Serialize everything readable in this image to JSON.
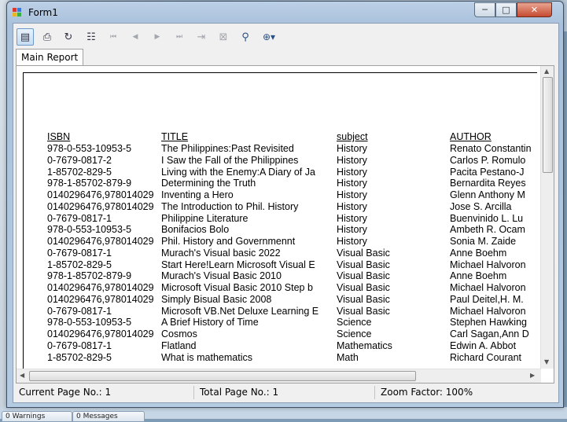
{
  "window": {
    "title": "Form1",
    "controls": {
      "minimize": "─",
      "maximize": "□",
      "close": "✕"
    }
  },
  "toolbar": {
    "buttons": [
      {
        "name": "export-report-icon",
        "glyph": "▤"
      },
      {
        "name": "print-icon",
        "glyph": "⎙"
      },
      {
        "name": "refresh-icon",
        "glyph": "↻"
      },
      {
        "name": "toggle-group-tree-icon",
        "glyph": "☷"
      },
      {
        "name": "first-page-icon",
        "glyph": "⏮"
      },
      {
        "name": "previous-page-icon",
        "glyph": "◀"
      },
      {
        "name": "next-page-icon",
        "glyph": "▶"
      },
      {
        "name": "last-page-icon",
        "glyph": "⏭"
      },
      {
        "name": "go-to-page-icon",
        "glyph": "⇥"
      },
      {
        "name": "close-current-view-icon",
        "glyph": "⊠"
      },
      {
        "name": "find-binoculars-icon",
        "glyph": "⚲"
      },
      {
        "name": "zoom-icon",
        "glyph": "⊕▾"
      }
    ]
  },
  "tab": {
    "label": "Main Report"
  },
  "report": {
    "headers": {
      "isbn": "ISBN",
      "title": "TITLE",
      "subject": "subject",
      "author": "AUTHOR"
    },
    "rows": [
      {
        "isbn": "978-0-553-10953-5",
        "title": "The Philippines:Past Revisited",
        "subject": "History",
        "author": "Renato Constantin"
      },
      {
        "isbn": "0-7679-0817-2",
        "title": "I Saw the Fall of the Philippines",
        "subject": "History",
        "author": "Carlos P. Romulo"
      },
      {
        "isbn": "1-85702-829-5",
        "title": "Living with the Enemy:A Diary of Ja",
        "subject": "History",
        "author": "Pacita Pestano-J"
      },
      {
        "isbn": "978-1-85702-879-9",
        "title": "Determining the Truth",
        "subject": "History",
        "author": "Bernardita Reyes"
      },
      {
        "isbn": "0140296476,978014029",
        "title": "Inventing a Hero",
        "subject": "History",
        "author": "Glenn Anthony M"
      },
      {
        "isbn": "0140296476,978014029",
        "title": "The Introduction to Phil. History",
        "subject": "History",
        "author": "Jose S. Arcilla"
      },
      {
        "isbn": "0-7679-0817-1",
        "title": "Philippine Literature",
        "subject": "History",
        "author": "Buenvinido L. Lu"
      },
      {
        "isbn": "978-0-553-10953-5",
        "title": "Bonifacios Bolo",
        "subject": "History",
        "author": "Ambeth R. Ocam"
      },
      {
        "isbn": "0140296476,978014029",
        "title": "Phil. History and Governmennt",
        "subject": "History",
        "author": "Sonia M. Zaide"
      },
      {
        "isbn": "0-7679-0817-1",
        "title": "Murach's Visual basic 2022",
        "subject": "Visual Basic",
        "author": "Anne Boehm"
      },
      {
        "isbn": "1-85702-829-5",
        "title": "Start Here!Learn Microsoft Visual E",
        "subject": "Visual Basic",
        "author": "Michael Halvoron"
      },
      {
        "isbn": "978-1-85702-879-9",
        "title": "Murach's Visual Basic 2010",
        "subject": "Visual Basic",
        "author": "Anne Boehm"
      },
      {
        "isbn": "0140296476,978014029",
        "title": "Microsoft Visual Basic 2010 Step b",
        "subject": "Visual Basic",
        "author": "Michael Halvoron"
      },
      {
        "isbn": "0140296476,978014029",
        "title": "Simply Bisual Basic 2008",
        "subject": "Visual Basic",
        "author": "Paul Deitel,H. M."
      },
      {
        "isbn": "0-7679-0817-1",
        "title": "Microsoft VB.Net Deluxe Learning E",
        "subject": "Visual Basic",
        "author": "Michael Halvoron"
      },
      {
        "isbn": "978-0-553-10953-5",
        "title": "A Brief History of Time",
        "subject": "Science",
        "author": "Stephen Hawking"
      },
      {
        "isbn": "0140296476,978014029",
        "title": "Cosmos",
        "subject": "Science",
        "author": "Carl Sagan,Ann D"
      },
      {
        "isbn": "0-7679-0817-1",
        "title": "Flatland",
        "subject": "Mathematics",
        "author": "Edwin A. Abbot"
      },
      {
        "isbn": "1-85702-829-5",
        "title": "What is mathematics",
        "subject": "Math",
        "author": "Richard Courant"
      }
    ]
  },
  "status": {
    "current_page": "Current Page No.: 1",
    "total_page": "Total Page No.: 1",
    "zoom": "Zoom Factor: 100%"
  },
  "taskbar": {
    "items": [
      "0 Warnings",
      "0 Messages"
    ]
  }
}
